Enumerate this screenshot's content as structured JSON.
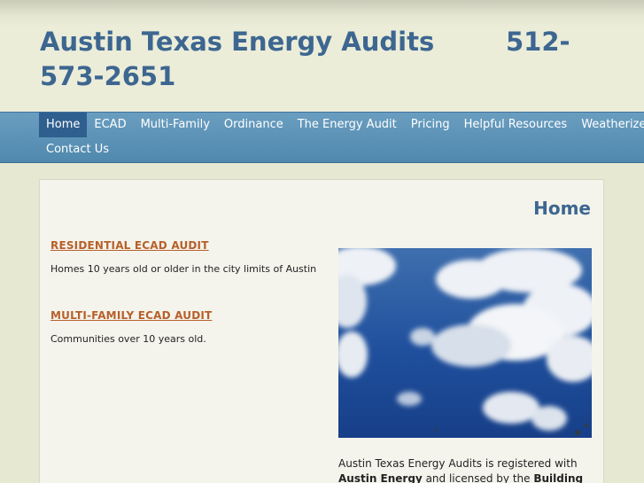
{
  "site": {
    "title": "Austin Texas Energy Audits        512-573-2651"
  },
  "nav": {
    "items": [
      {
        "label": "Home",
        "active": true
      },
      {
        "label": "ECAD"
      },
      {
        "label": "Multi-Family"
      },
      {
        "label": "Ordinance"
      },
      {
        "label": "The Energy Audit"
      },
      {
        "label": "Pricing"
      },
      {
        "label": "Helpful Resources"
      },
      {
        "label": "Weatherize"
      },
      {
        "label": "Contact Us"
      }
    ]
  },
  "main": {
    "heading": "Home",
    "sections": [
      {
        "link": "RESIDENTIAL ECAD AUDIT",
        "text": "Homes 10 years old or older in the city limits of Austin"
      },
      {
        "link": "MULTI-FAMILY ECAD AUDIT",
        "text": "Communities over 10 years old."
      }
    ],
    "caption": {
      "line1": " Austin Texas Energy Audits  is registered with",
      "bold1": "Austin Energy",
      "mid": " and  licensed by the ",
      "bold2": "Building"
    }
  },
  "colors": {
    "title": "#3d6690",
    "nav_bg": "#4f87ad",
    "nav_active": "#2f5f8e",
    "link": "#b8602a"
  },
  "icons": {
    "photo": "cloudy-sky-image"
  }
}
